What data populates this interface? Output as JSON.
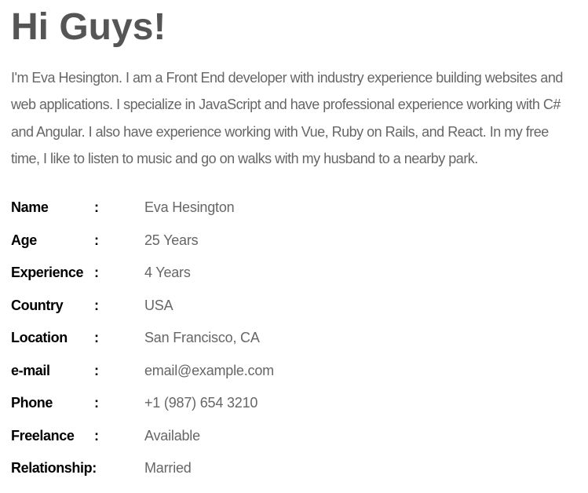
{
  "heading": "Hi Guys!",
  "intro": "I'm Eva Hesington. I am a Front End developer with industry experience building websites and web applications. I specialize in JavaScript and have professional experience working with C# and Angular. I also have experience working with Vue, Ruby on Rails, and React. In my free time, I like to listen to music and go on walks with my husband to a nearby park.",
  "details": [
    {
      "label": "Name",
      "colon": ":",
      "value": "Eva Hesington"
    },
    {
      "label": "Age",
      "colon": ":",
      "value": "25 Years"
    },
    {
      "label": "Experience",
      "colon": ":",
      "value": "4 Years"
    },
    {
      "label": "Country",
      "colon": ":",
      "value": "USA"
    },
    {
      "label": "Location",
      "colon": ":",
      "value": "San Francisco, CA"
    },
    {
      "label": "e-mail",
      "colon": ":",
      "value": "email@example.com"
    },
    {
      "label": "Phone",
      "colon": ":",
      "value": "+1 (987) 654 3210"
    },
    {
      "label": "Freelance",
      "colon": ":",
      "value": "Available"
    },
    {
      "label": "Relationship:",
      "colon": "",
      "value": "Married"
    }
  ]
}
